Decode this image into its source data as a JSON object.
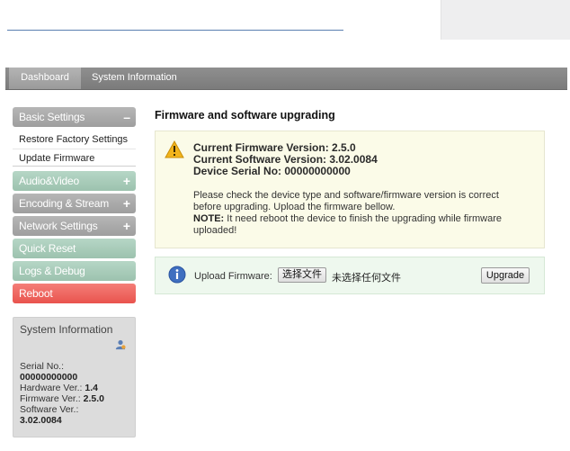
{
  "navbar": {
    "tabs": [
      {
        "label": "Dashboard",
        "active": true
      },
      {
        "label": "System Information",
        "active": false
      }
    ]
  },
  "sidebar": {
    "basic_settings": {
      "label": "Basic Settings",
      "sign": "–"
    },
    "sub_items": [
      {
        "label": "Restore Factory Settings"
      },
      {
        "label": "Update Firmware"
      }
    ],
    "audio_video": {
      "label": "Audio&Video",
      "sign": "+"
    },
    "encoding_stream": {
      "label": "Encoding & Stream",
      "sign": "+"
    },
    "network_settings": {
      "label": "Network Settings",
      "sign": "+"
    },
    "quick_reset": {
      "label": "Quick Reset"
    },
    "logs_debug": {
      "label": "Logs & Debug"
    },
    "reboot": {
      "label": "Reboot"
    }
  },
  "system_info": {
    "title": "System Information",
    "serial_label": "Serial No.:",
    "serial_value": "00000000000",
    "hardware_label": "Hardware Ver.:",
    "hardware_value": "1.4",
    "firmware_label": "Firmware Ver.:",
    "firmware_value": "2.5.0",
    "software_label": "Software Ver.:",
    "software_value": "3.02.0084"
  },
  "main": {
    "title": "Firmware and software upgrading",
    "current_firmware": "Current Firmware Version: 2.5.0",
    "current_software": "Current Software Version: 3.02.0084",
    "device_serial": "Device Serial No: 00000000000",
    "note_text": "Please check the device type and software/firmware version is correct before upgrading. Upload the firmware bellow.",
    "note_label": "NOTE:",
    "note_reboot": " It need reboot the device to finish the upgrading while firmware uploaded!",
    "upload_label": "Upload Firmware:",
    "choose_file": "选择文件",
    "no_file": "未选择任何文件",
    "upgrade_button": "Upgrade"
  },
  "colors": {
    "sidebar_grey": "#a8a8a8",
    "sidebar_green": "#a6c8b6",
    "reboot_red": "#ee6460",
    "notice_panel": "#fbfbe8",
    "upload_panel": "#eef8ee"
  }
}
